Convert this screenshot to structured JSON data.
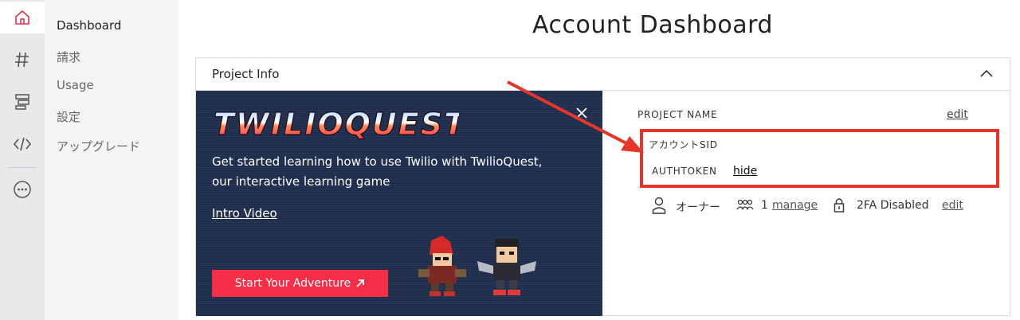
{
  "rail": {
    "icons": [
      "home-icon",
      "hash-icon",
      "layout-icon",
      "code-icon",
      "more-icon"
    ]
  },
  "nav": {
    "items": [
      {
        "label": "Dashboard",
        "active": true
      },
      {
        "label": "請求",
        "active": false
      },
      {
        "label": "Usage",
        "active": false
      },
      {
        "label": "設定",
        "active": false
      },
      {
        "label": "アップグレード",
        "active": false
      }
    ]
  },
  "page_title": "Account Dashboard",
  "card": {
    "title": "Project Info",
    "banner": {
      "logo_text": "TWILIOQUEST",
      "description": "Get started learning how to use Twilio with TwilioQuest, our interactive learning game",
      "intro_link": "Intro Video",
      "button_label": "Start Your Adventure"
    },
    "info": {
      "project_name_label": "PROJECT NAME",
      "edit_label": "edit",
      "account_sid_label": "アカウントSID",
      "authtoken_label": "AUTHTOKEN",
      "hide_label": "hide",
      "owner_label": "オーナー",
      "users_count": "1",
      "manage_label": "manage",
      "twofa_label": "2FA Disabled",
      "twofa_edit_label": "edit"
    }
  },
  "colors": {
    "accent": "#f22f46",
    "annotation": "#e8352a",
    "banner_bg": "#1f2d4d"
  }
}
